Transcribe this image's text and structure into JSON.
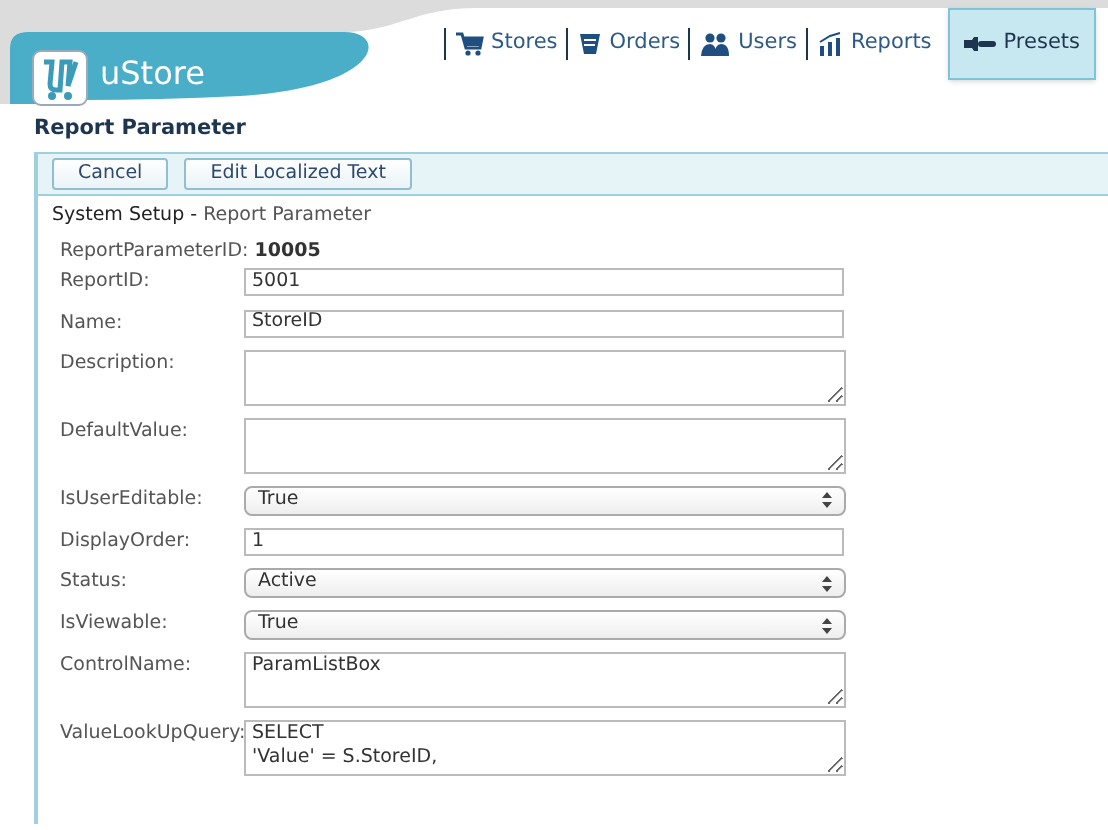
{
  "app": {
    "name": "uStore"
  },
  "nav": [
    {
      "label": "Stores",
      "selected": false
    },
    {
      "label": "Orders",
      "selected": false
    },
    {
      "label": "Users",
      "selected": false
    },
    {
      "label": "Reports",
      "selected": false
    },
    {
      "label": "Presets",
      "selected": true
    }
  ],
  "page_title": "Report Parameter",
  "toolbar": [
    "Cancel",
    "Edit Localized Text"
  ],
  "breadcrumb": {
    "section": "System Setup",
    "separator": "-",
    "page": "Report Parameter"
  },
  "record_id": {
    "label": "ReportParameterID:",
    "value": "10005"
  },
  "fields": [
    {
      "label": "ReportID:",
      "kind": "text",
      "value": "5001"
    },
    {
      "label": "Name:",
      "kind": "text",
      "value": "StoreID"
    },
    {
      "label": "Description:",
      "kind": "textarea"
    },
    {
      "label": "DefaultValue:",
      "kind": "textarea"
    },
    {
      "label": "IsUserEditable:",
      "kind": "select",
      "value": "True"
    },
    {
      "label": "DisplayOrder:",
      "kind": "text",
      "value": "1"
    },
    {
      "label": "Status:",
      "kind": "select",
      "value": "Active"
    },
    {
      "label": "IsViewable:",
      "kind": "select",
      "value": "True"
    },
    {
      "label": "ControlName:",
      "kind": "textarea",
      "value": "ParamListBox"
    },
    {
      "label": "ValueLookUpQuery:",
      "kind": "textarea",
      "value": "SELECT\n'Value' = S.StoreID,"
    }
  ]
}
